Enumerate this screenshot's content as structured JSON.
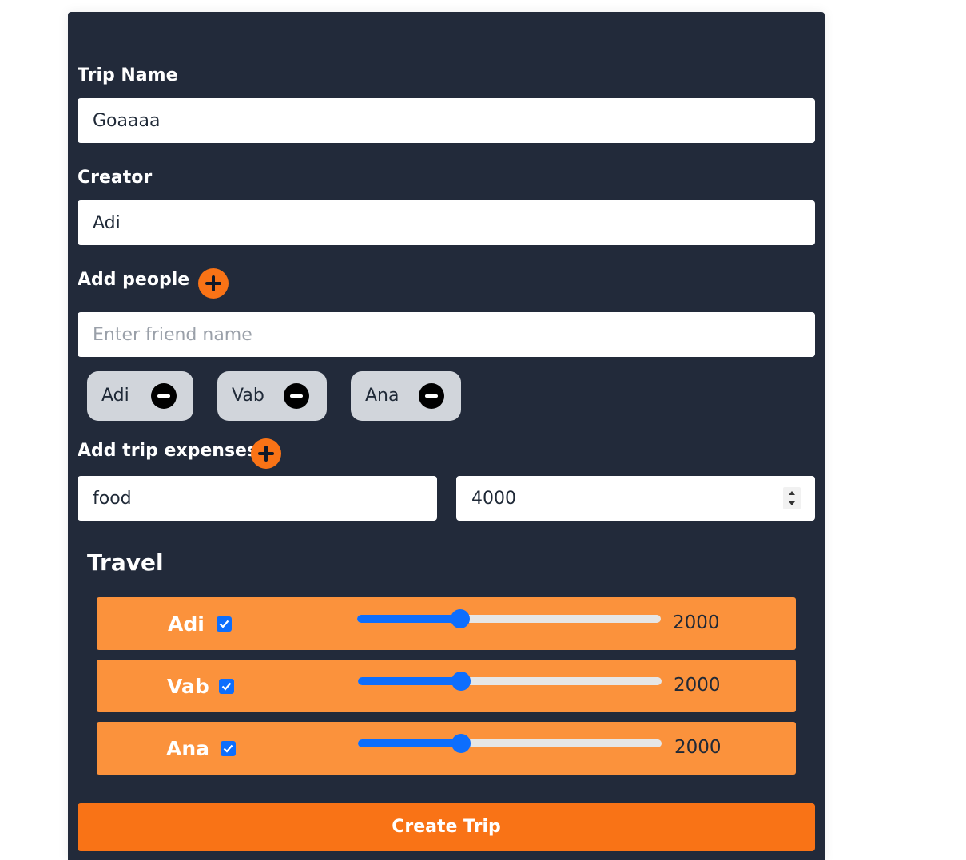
{
  "form": {
    "trip_name_label": "Trip Name",
    "trip_name_value": "Goaaaa",
    "creator_label": "Creator",
    "creator_value": "Adi",
    "add_people_label": "Add people",
    "friend_placeholder": "Enter friend name",
    "people": [
      "Adi",
      "Vab",
      "Ana"
    ],
    "add_expenses_label": "Add trip expenses",
    "expense_name_value": "food",
    "expense_amount_value": "4000"
  },
  "travel": {
    "title": "Travel",
    "rows": [
      {
        "name": "Adi",
        "checked": true,
        "slider_fraction": 0.34,
        "amount": "2000"
      },
      {
        "name": "Vab",
        "checked": true,
        "slider_fraction": 0.34,
        "amount": "2000"
      },
      {
        "name": "Ana",
        "checked": true,
        "slider_fraction": 0.34,
        "amount": "2000"
      }
    ]
  },
  "actions": {
    "create_label": "Create Trip"
  },
  "icons": {
    "add": "plus-circle-icon",
    "remove": "minus-circle-icon",
    "check": "checkmark-icon"
  },
  "colors": {
    "card_bg": "#222a3a",
    "accent": "#f97316",
    "row_bg": "#fb923c",
    "slider": "#0d6efd",
    "chip_bg": "#d1d5db"
  }
}
